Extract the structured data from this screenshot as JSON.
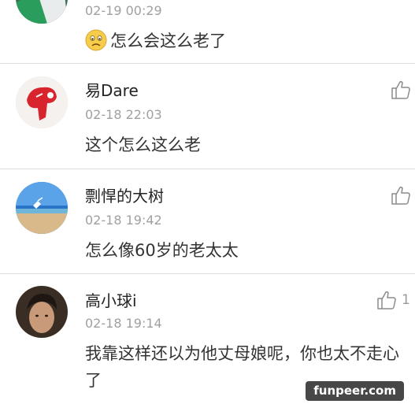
{
  "comments": [
    {
      "username": "",
      "timestamp": "02-19 00:29",
      "emoji": "sad-face",
      "content": "怎么会这么老了",
      "like_count": ""
    },
    {
      "username": "易Dare",
      "timestamp": "02-18 22:03",
      "content": "这个怎么这么老",
      "like_count": ""
    },
    {
      "username": "剽悍的大树",
      "timestamp": "02-18 19:42",
      "content": "怎么像60岁的老太太",
      "like_count": ""
    },
    {
      "username": "高小球i",
      "timestamp": "02-18 19:14",
      "content": "我靠这样还以为他丈母娘呢，你也太不走心了",
      "like_count": "1"
    }
  ],
  "icons": {
    "like": "thumbs-up-icon",
    "emoji": "sad-face-icon"
  },
  "watermark": "funpeer.com",
  "colors": {
    "divider": "#dedede",
    "timestamp": "#a0a0a0",
    "text": "#333333",
    "icon": "#8c8c8c"
  }
}
